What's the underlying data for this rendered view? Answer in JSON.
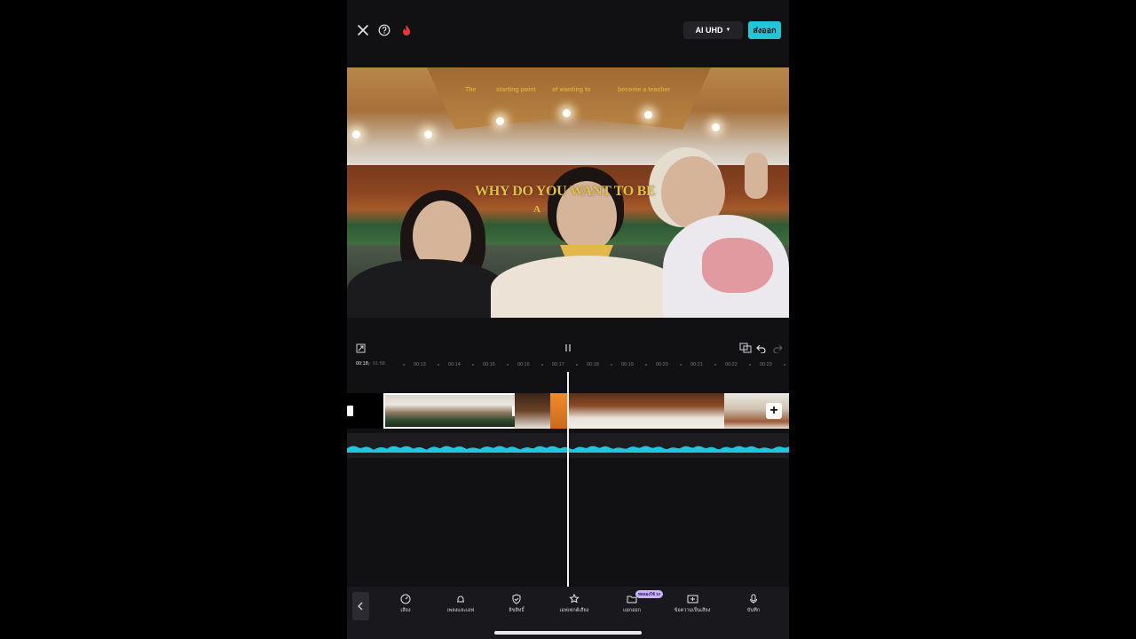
{
  "topbar": {
    "close_icon": "close-icon",
    "help_icon": "help-icon",
    "promo_icon": "flame-icon",
    "quality_label": "AI UHD",
    "export_label": "ส่งออก",
    "export_color": "#21c6d9"
  },
  "preview": {
    "overlay_words": [
      "The",
      "starting point",
      "of wanting to",
      "become a teacher"
    ],
    "title_line1": "WHY DO YOU WANT TO BE",
    "title_line2": "A"
  },
  "playback": {
    "fullscreen_icon": "fullscreen-icon",
    "play_state_icon": "pause-icon",
    "keyframe_icon": "keyframe-icon",
    "undo_icon": "undo-icon",
    "redo_icon": "redo-icon"
  },
  "ruler": {
    "current_time": "00:18",
    "separator": "/",
    "total_time": "01:58",
    "ticks": [
      "00:13",
      "00:14",
      "00:15",
      "00:16",
      "00:17",
      "00:18",
      "00:19",
      "00:20",
      "00:21",
      "00:22",
      "00:23"
    ]
  },
  "timeline": {
    "add_clip_label": "+",
    "waveform_color": "#21c6d9"
  },
  "toolbar": {
    "new_badge": "ทดลองใช้ 10",
    "items": [
      {
        "icon": "speed-icon",
        "label": "เสียง"
      },
      {
        "icon": "sound-effects-icon",
        "label": "เพลงและเอฟ"
      },
      {
        "icon": "copyright-shield-icon",
        "label": "ลิขสิทธิ์"
      },
      {
        "icon": "voice-effects-icon",
        "label": "เอฟเฟกต์เสียง"
      },
      {
        "icon": "extract-folder-icon",
        "label": "แยกออก"
      },
      {
        "icon": "text-to-speech-icon",
        "label": "ข้อความเป็นเสียง"
      },
      {
        "icon": "microphone-icon",
        "label": "บันทึก"
      }
    ]
  }
}
